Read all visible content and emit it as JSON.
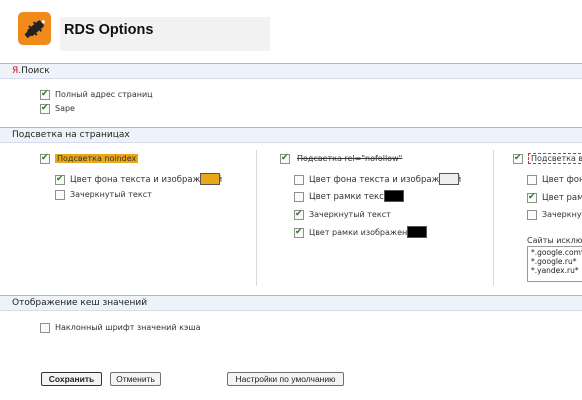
{
  "header": {
    "title": "RDS Options",
    "logo_icon": "rds-logo-icon"
  },
  "sections": {
    "yandex": {
      "title_prefix": "Я.",
      "title_suffix": "Поиск"
    },
    "highlight": {
      "title": "Подсветка на страницах"
    },
    "cache": {
      "title": "Отображение кеш значений"
    }
  },
  "yandex_options": [
    {
      "label": "Полный адрес страниц",
      "checked": true
    },
    {
      "label": "Sape",
      "checked": true
    }
  ],
  "highlight": {
    "nonindex": {
      "label": "Подсветка noindex",
      "checked": true,
      "options": [
        {
          "label": "Цвет фона текста и изображений",
          "checked": true,
          "swatch": "#e9a719"
        },
        {
          "label": "Зачеркнутый текст",
          "checked": false
        }
      ]
    },
    "nofollow": {
      "label": "Подсветка rel=\"nofollow\"",
      "checked": true,
      "options": [
        {
          "label": "Цвет фона текста и изображений",
          "checked": false,
          "swatch": "#eeeeee"
        },
        {
          "label": "Цвет рамки текста",
          "checked": false,
          "swatch": "#000000"
        },
        {
          "label": "Зачеркнутый текст",
          "checked": true
        },
        {
          "label": "Цвет рамки изображений",
          "checked": true,
          "swatch": "#000000"
        }
      ]
    },
    "external": {
      "label": "Подсветка вн",
      "checked": true,
      "options": [
        {
          "label": "Цвет фона",
          "checked": false
        },
        {
          "label": "Цвет рамо",
          "checked": true
        },
        {
          "label": "Зачеркнут",
          "checked": false
        }
      ],
      "exclusions_label": "Сайты исключ",
      "exclusions": [
        "*.google.com*",
        "*.google.ru*",
        "*.yandex.ru*"
      ]
    }
  },
  "cache_options": [
    {
      "label": "Наклонный шрифт значений кэша",
      "checked": false
    }
  ],
  "buttons": {
    "save": "Сохранить",
    "cancel": "Отменить",
    "defaults": "Настройки по умолчанию"
  },
  "colors": {
    "accent": "#f08a1a",
    "section_bg": "#eef3fa",
    "nonindex": "#e9a719"
  }
}
